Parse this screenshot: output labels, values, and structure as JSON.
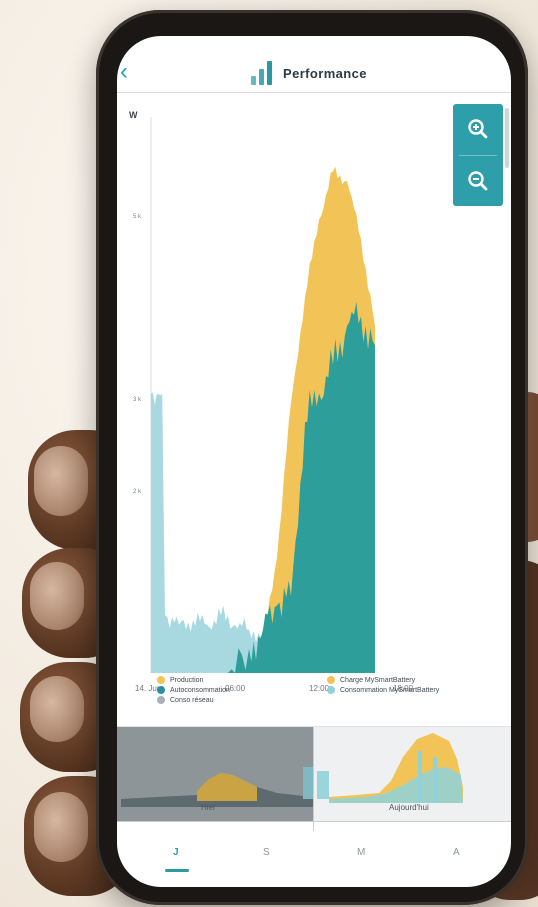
{
  "header": {
    "title": "Performance",
    "back_icon": "chevron-left-icon",
    "title_icon": "bar-chart-icon"
  },
  "zoom": {
    "zoom_in_icon": "zoom-in-icon",
    "zoom_out_icon": "zoom-out-icon"
  },
  "chart_data": {
    "type": "area",
    "ylabel": "W",
    "y_ticks": [
      "5 k",
      "3 k",
      "2 k"
    ],
    "x_ticks": [
      "14. Jun",
      "06:00",
      "12:00",
      "18:00"
    ],
    "x_unit": "hour of day",
    "series": [
      {
        "name": "Production",
        "color": "#f2c457",
        "x": [
          7,
          8,
          9,
          10,
          11,
          12,
          13,
          14,
          15,
          16
        ],
        "values": [
          0,
          0.3,
          1.2,
          2.8,
          3.9,
          4.7,
          5.2,
          5.1,
          4.5,
          3.6
        ]
      },
      {
        "name": "Autoconsommation",
        "color": "#2e9e9a",
        "x": [
          5.5,
          7,
          8,
          9,
          10,
          11,
          12,
          13,
          14,
          15,
          16
        ],
        "values": [
          0,
          0.25,
          0.45,
          0.7,
          0.8,
          2.6,
          2.9,
          3.2,
          3.6,
          3.7,
          3.4
        ]
      },
      {
        "name": "Charge MySmartBattery",
        "color": "#f2c457",
        "x": [],
        "values": []
      },
      {
        "name": "Consommation MySmartBattery",
        "color": "#8ed3dc",
        "x": [],
        "values": []
      },
      {
        "name": "Conso réseau",
        "color": "#a8b2b8",
        "x": [
          0,
          0.8,
          1,
          2,
          3,
          4,
          5,
          6,
          7,
          8,
          9
        ],
        "values": [
          2.9,
          2.9,
          0.6,
          0.5,
          0.55,
          0.5,
          0.6,
          0.5,
          0.45,
          0.4,
          0.3
        ]
      }
    ],
    "legend_position": "bottom"
  },
  "legend": {
    "production": "Production",
    "autoconsommation": "Autoconsommation",
    "conso_reseau": "Conso réseau",
    "charge_battery": "Charge MySmartBattery",
    "conso_battery": "Consommation MySmartBattery"
  },
  "navigator": {
    "left_label": "Hier",
    "right_label": "Aujourd'hui"
  },
  "tabs": [
    {
      "label": "J",
      "active": true
    },
    {
      "label": "S",
      "active": false
    },
    {
      "label": "M",
      "active": false
    },
    {
      "label": "A",
      "active": false
    }
  ],
  "colors": {
    "accent": "#2a9aa2",
    "production": "#f2c457",
    "autoconsommation": "#2e9e9a",
    "consommation_light": "#8ed3dc",
    "reseau": "#a8b2b8"
  }
}
